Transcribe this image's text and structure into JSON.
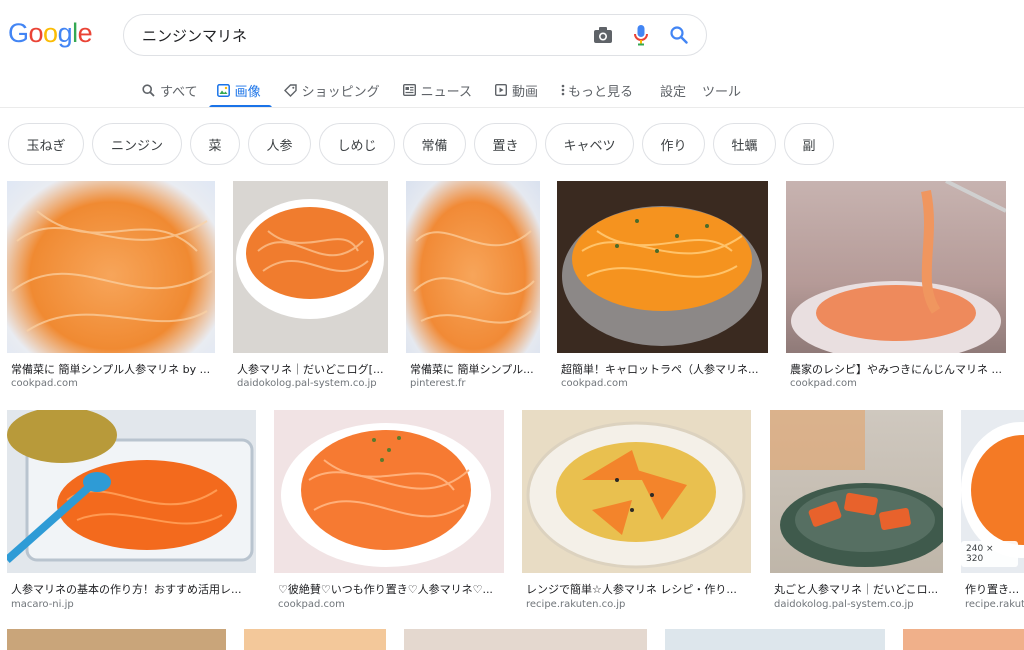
{
  "logo": {
    "text": "Google"
  },
  "search": {
    "query": "ニンジンマリネ"
  },
  "tabs": [
    {
      "label": "すべて",
      "icon": "search-icon"
    },
    {
      "label": "画像",
      "icon": "image-icon"
    },
    {
      "label": "ショッピング",
      "icon": "tag-icon"
    },
    {
      "label": "ニュース",
      "icon": "news-icon"
    },
    {
      "label": "動画",
      "icon": "play-icon"
    },
    {
      "label": "もっと見る",
      "icon": "more-vert-icon"
    },
    {
      "label": "設定"
    },
    {
      "label": "ツール"
    }
  ],
  "chips": [
    "玉ねぎ",
    "ニンジン",
    "菜",
    "人参",
    "しめじ",
    "常備",
    "置き",
    "キャベツ",
    "作り",
    "牡蠣",
    "副"
  ],
  "results_row1": [
    {
      "title": "常備菜に 簡単シンプル人参マリネ by ...",
      "site": "cookpad.com"
    },
    {
      "title": "人参マリネ｜だいどこログ[...",
      "site": "daidokolog.pal-system.co.jp"
    },
    {
      "title": "常備菜に 簡単シンプル...",
      "site": "pinterest.fr"
    },
    {
      "title": "超簡単！キャロットラペ（人参マリネ...",
      "site": "cookpad.com"
    },
    {
      "title": "農家のレシピ】やみつきにんじんマリネ ...",
      "site": "cookpad.com"
    }
  ],
  "results_row2": [
    {
      "title": "人参マリネの基本の作り方！おすすめ活用レ...",
      "site": "macaro-ni.jp"
    },
    {
      "title": "♡彼絶賛♡いつも作り置き♡人参マリネ♡...",
      "site": "cookpad.com"
    },
    {
      "title": "レンジで簡単☆人参マリネ レシピ・作り...",
      "site": "recipe.rakuten.co.jp"
    },
    {
      "title": "丸ごと人参マリネ｜だいどこロ...",
      "site": "daidokolog.pal-system.co.jp"
    },
    {
      "title": "作り置き、...",
      "site": "recipe.rakuten...",
      "badge": "240 × 320"
    }
  ],
  "colors": {
    "accent": "#1a73e8",
    "food": "#f4a04b"
  }
}
